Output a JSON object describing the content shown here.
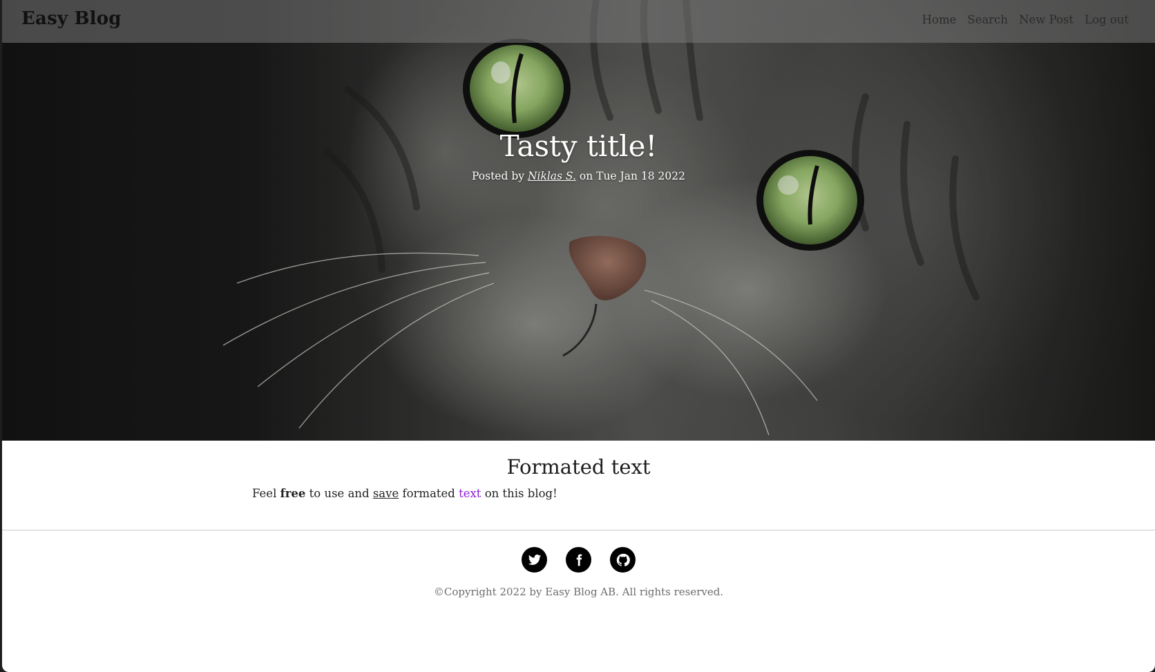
{
  "navbar": {
    "brand": "Easy Blog",
    "links": [
      "Home",
      "Search",
      "New Post",
      "Log out"
    ]
  },
  "hero": {
    "title": "Tasty title!",
    "meta_prefix": "Posted by ",
    "author": "Niklas S.",
    "meta_date": " on Tue Jan 18 2022"
  },
  "content": {
    "heading": "Formated text",
    "body": {
      "p1": "Feel ",
      "bold": "free",
      "p2": " to use and ",
      "underlined": "save",
      "p3": " formated ",
      "colored": "text",
      "p4": " on this blog!",
      "colored_color": "#8a1cd6"
    }
  },
  "footer": {
    "social_icons": [
      "twitter-icon",
      "facebook-icon",
      "github-icon"
    ],
    "copyright": "©Copyright 2022 by Easy Blog AB. All rights reserved."
  }
}
